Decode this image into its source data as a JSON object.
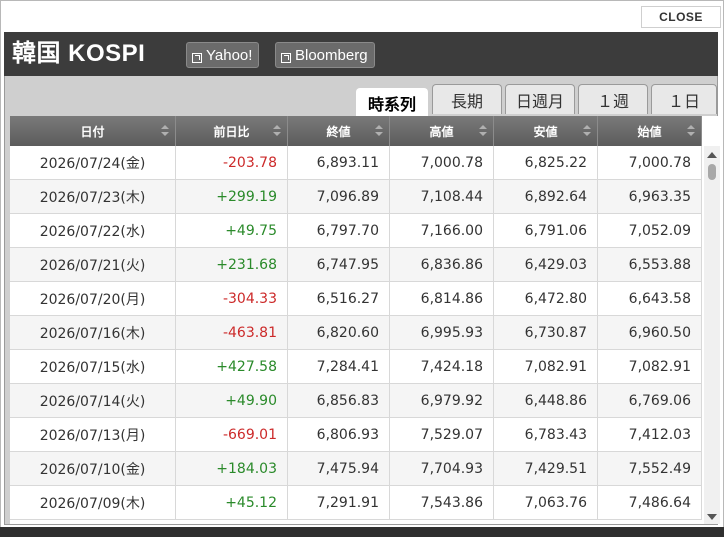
{
  "close_label": "CLOSE",
  "title": "韓国 KOSPI",
  "links": [
    {
      "label": "Yahoo!"
    },
    {
      "label": "Bloomberg"
    }
  ],
  "tabs": [
    {
      "label": "時系列",
      "active": true
    },
    {
      "label": "長期",
      "active": false
    },
    {
      "label": "日週月",
      "active": false
    },
    {
      "label": "１週",
      "active": false
    },
    {
      "label": "１日",
      "active": false
    }
  ],
  "columns": [
    "日付",
    "前日比",
    "終値",
    "高値",
    "安値",
    "始値"
  ],
  "rows": [
    {
      "date": "2026/07/24(金)",
      "change": "-203.78",
      "close": "6,893.11",
      "high": "7,000.78",
      "low": "6,825.22",
      "open": "7,000.78"
    },
    {
      "date": "2026/07/23(木)",
      "change": "+299.19",
      "close": "7,096.89",
      "high": "7,108.44",
      "low": "6,892.64",
      "open": "6,963.35"
    },
    {
      "date": "2026/07/22(水)",
      "change": "+49.75",
      "close": "6,797.70",
      "high": "7,166.00",
      "low": "6,791.06",
      "open": "7,052.09"
    },
    {
      "date": "2026/07/21(火)",
      "change": "+231.68",
      "close": "6,747.95",
      "high": "6,836.86",
      "low": "6,429.03",
      "open": "6,553.88"
    },
    {
      "date": "2026/07/20(月)",
      "change": "-304.33",
      "close": "6,516.27",
      "high": "6,814.86",
      "low": "6,472.80",
      "open": "6,643.58"
    },
    {
      "date": "2026/07/16(木)",
      "change": "-463.81",
      "close": "6,820.60",
      "high": "6,995.93",
      "low": "6,730.87",
      "open": "6,960.50"
    },
    {
      "date": "2026/07/15(水)",
      "change": "+427.58",
      "close": "7,284.41",
      "high": "7,424.18",
      "low": "7,082.91",
      "open": "7,082.91"
    },
    {
      "date": "2026/07/14(火)",
      "change": "+49.90",
      "close": "6,856.83",
      "high": "6,979.92",
      "low": "6,448.86",
      "open": "6,769.06"
    },
    {
      "date": "2026/07/13(月)",
      "change": "-669.01",
      "close": "6,806.93",
      "high": "7,529.07",
      "low": "6,783.43",
      "open": "7,412.03"
    },
    {
      "date": "2026/07/10(金)",
      "change": "+184.03",
      "close": "7,475.94",
      "high": "7,704.93",
      "low": "7,429.51",
      "open": "7,552.49"
    },
    {
      "date": "2026/07/09(木)",
      "change": "+45.12",
      "close": "7,291.91",
      "high": "7,543.86",
      "low": "7,063.76",
      "open": "7,486.64"
    }
  ],
  "colors": {
    "negative": "#cc2a2a",
    "positive": "#2a8a2a",
    "header": "#3c3c3c"
  },
  "icons": {
    "close": "close-button",
    "external_link": "external-link-icon",
    "sort": "sort-icon"
  }
}
